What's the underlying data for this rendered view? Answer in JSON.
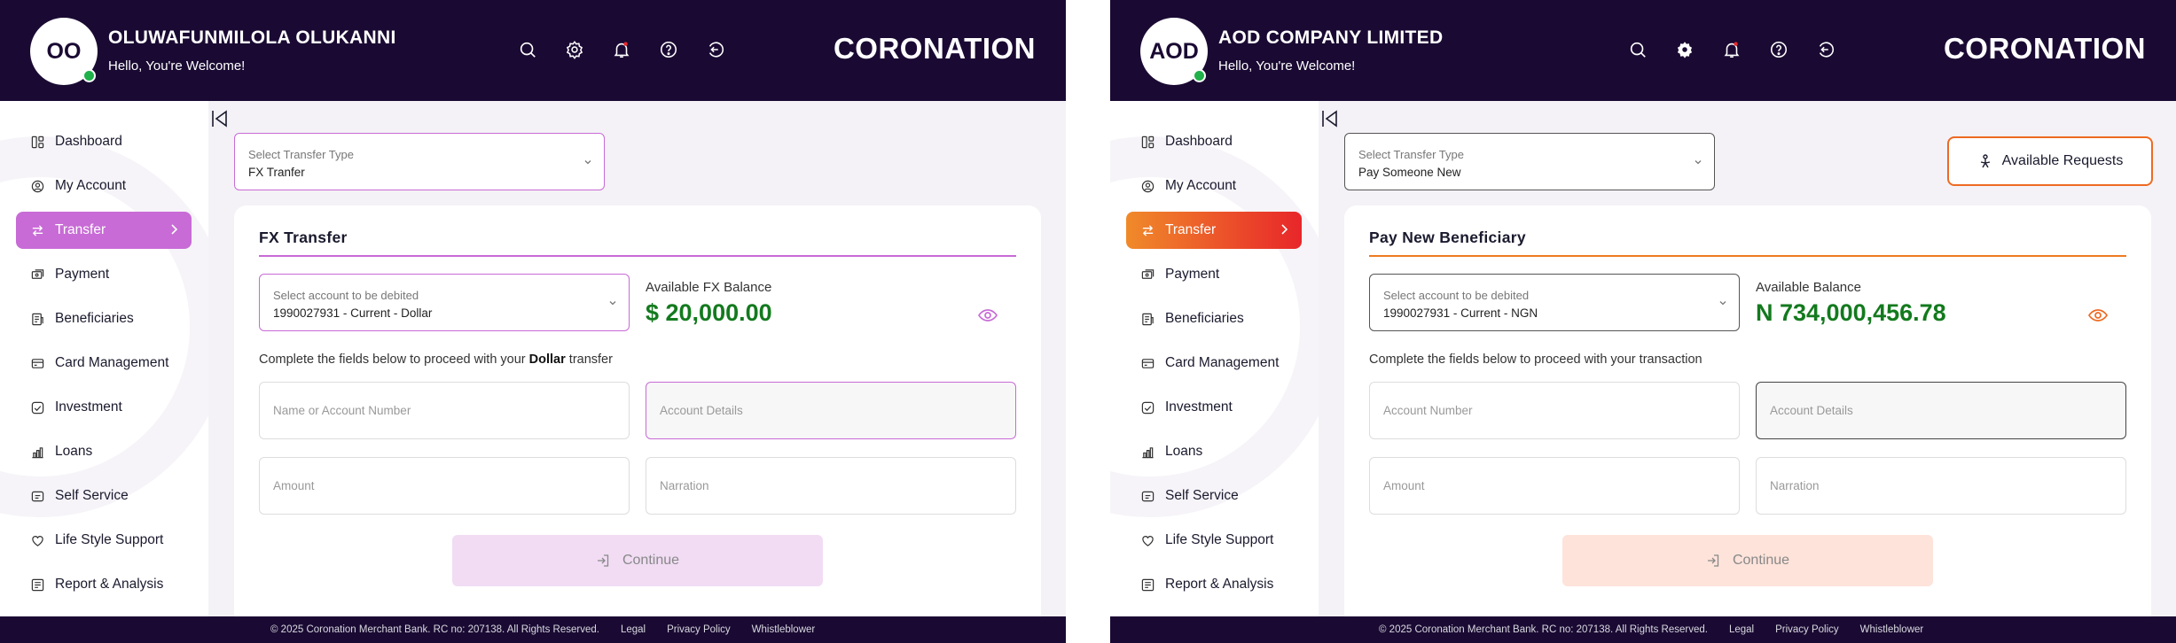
{
  "brand": {
    "logo": "CORONATION",
    "footer_copyright": "© 2025 Coronation Merchant Bank. RC no: 207138. All Rights Reserved.",
    "footer_links": [
      "Legal",
      "Privacy Policy",
      "Whistleblower"
    ]
  },
  "header_icons": [
    "search-icon",
    "settings-icon",
    "bell-icon",
    "help-icon",
    "logout-icon"
  ],
  "sidebar": {
    "items": [
      {
        "label": "Dashboard",
        "icon": "dashboard-icon"
      },
      {
        "label": "My Account",
        "icon": "user-icon"
      },
      {
        "label": "Transfer",
        "icon": "transfer-icon"
      },
      {
        "label": "Payment",
        "icon": "payment-icon"
      },
      {
        "label": "Beneficiaries",
        "icon": "beneficiaries-icon"
      },
      {
        "label": "Card Management",
        "icon": "card-icon"
      },
      {
        "label": "Investment",
        "icon": "investment-icon"
      },
      {
        "label": "Loans",
        "icon": "loans-icon"
      },
      {
        "label": "Self Service",
        "icon": "self-service-icon"
      },
      {
        "label": "Life Style Support",
        "icon": "heart-icon"
      },
      {
        "label": "Report & Analysis",
        "icon": "report-icon"
      }
    ]
  },
  "left": {
    "accent": "#c86bd6",
    "user": {
      "initials": "OO",
      "name": "OLUWAFUNMILOLA OLUKANNI",
      "greeting": "Hello, You're Welcome!"
    },
    "transfer_type": {
      "label": "Select Transfer Type",
      "value": "FX Tranfer"
    },
    "card": {
      "title": "FX Transfer",
      "debit": {
        "label": "Select account to be debited",
        "value": "1990027931 - Current - Dollar"
      },
      "balance": {
        "label": "Available FX Balance",
        "value": "$ 20,000.00"
      },
      "instruction_pre": "Complete the fields below to proceed with your ",
      "instruction_bold": "Dollar",
      "instruction_post": " transfer",
      "fields": {
        "name": "Name or Account Number",
        "details": "Account Details",
        "amount": "Amount",
        "narration": "Narration"
      },
      "continue": "Continue"
    }
  },
  "right": {
    "accent": "#ee7a22",
    "user": {
      "initials": "AOD",
      "name": "AOD COMPANY LIMITED",
      "greeting": "Hello, You're Welcome!"
    },
    "transfer_type": {
      "label": "Select Transfer Type",
      "value": "Pay Someone New"
    },
    "available_requests": "Available Requests",
    "card": {
      "title": "Pay New Beneficiary",
      "debit": {
        "label": "Select account to be debited",
        "value": "1990027931 - Current - NGN"
      },
      "balance": {
        "label": "Available Balance",
        "value": "N 734,000,456.78"
      },
      "instruction": "Complete the fields below to proceed with your transaction",
      "fields": {
        "name": "Account Number",
        "details": "Account Details",
        "amount": "Amount",
        "narration": "Narration"
      },
      "continue": "Continue"
    }
  }
}
